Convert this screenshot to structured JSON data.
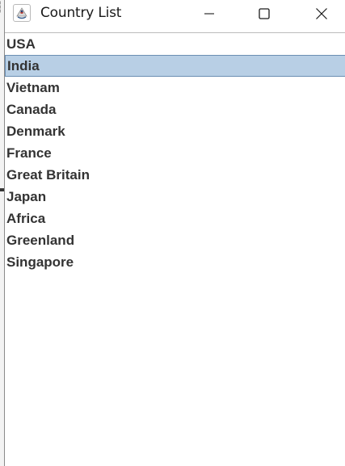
{
  "window": {
    "title": "Country List",
    "icon": "java-cup-icon"
  },
  "controls": {
    "minimize_icon": "minimize-icon",
    "maximize_icon": "maximize-icon",
    "close_icon": "close-icon"
  },
  "country_list": {
    "selected_index": 1,
    "selection_color": "#b8cfe5",
    "items": [
      {
        "label": "USA"
      },
      {
        "label": "India"
      },
      {
        "label": "Vietnam"
      },
      {
        "label": "Canada"
      },
      {
        "label": "Denmark"
      },
      {
        "label": "France"
      },
      {
        "label": "Great Britain"
      },
      {
        "label": "Japan"
      },
      {
        "label": "Africa"
      },
      {
        "label": "Greenland"
      },
      {
        "label": "Singapore"
      }
    ]
  }
}
